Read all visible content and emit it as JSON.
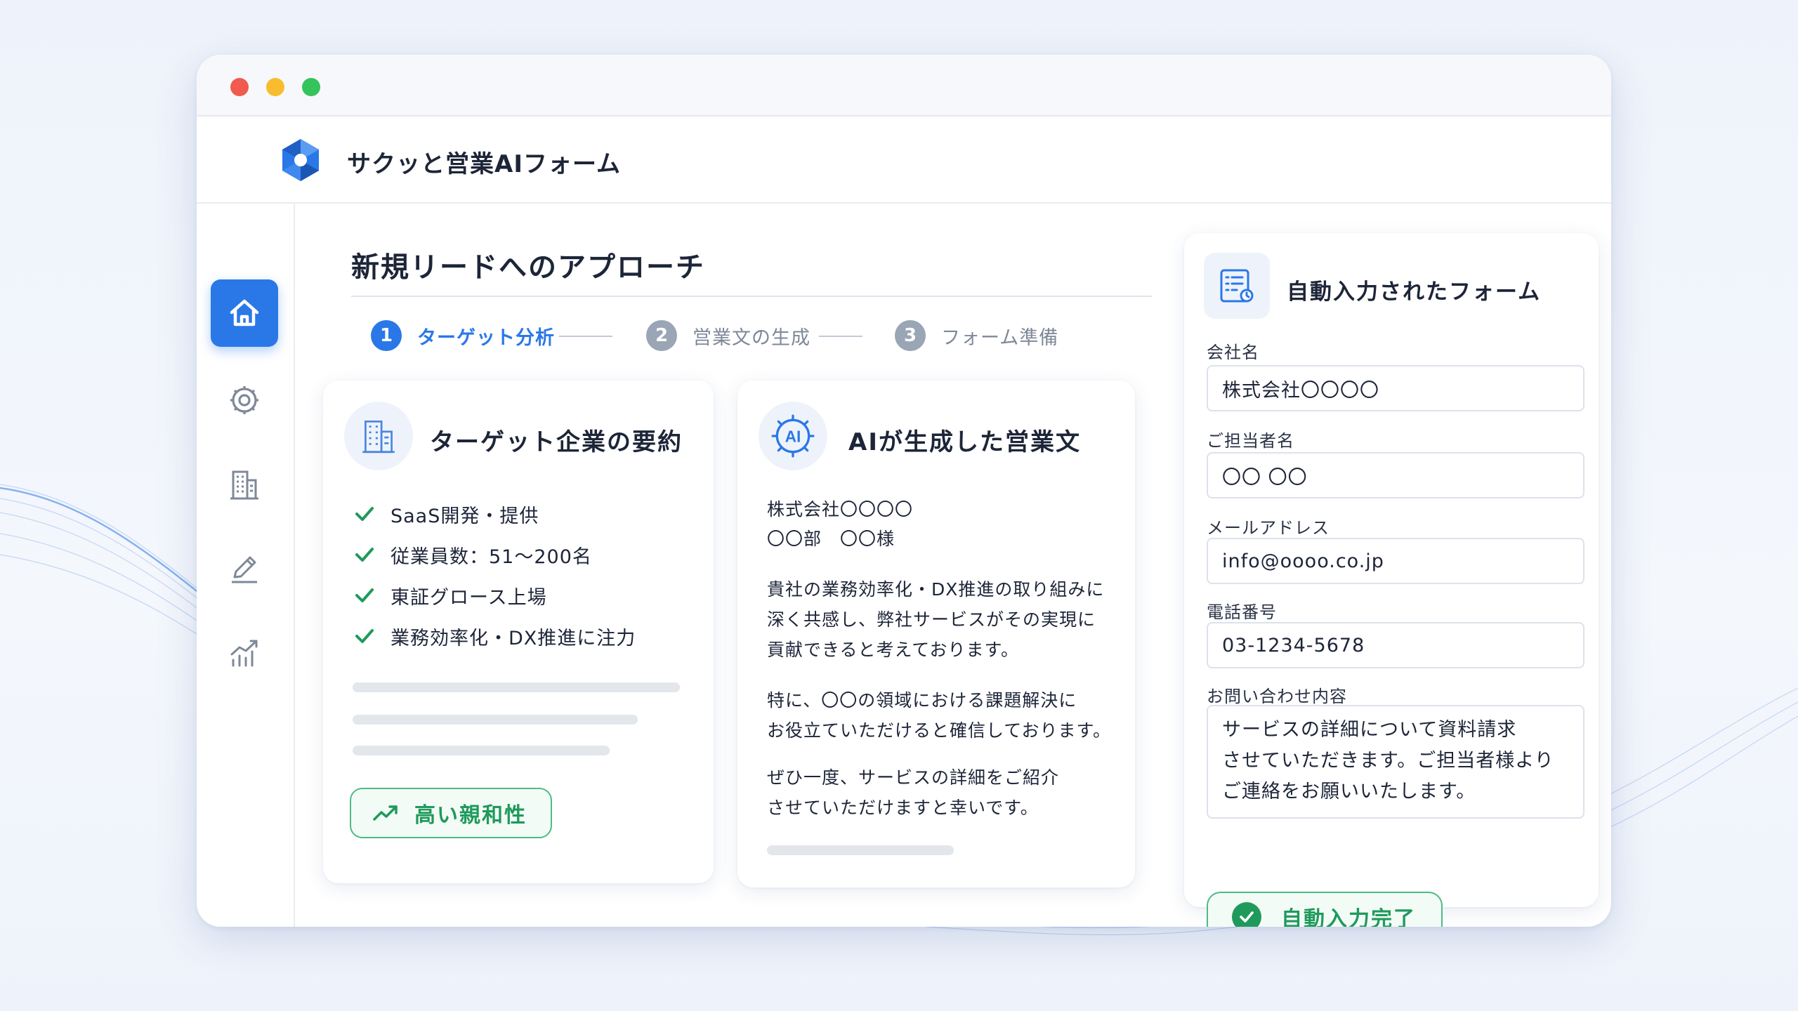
{
  "app": {
    "title": "サクッと営業AIフォーム",
    "accent_color": "#2a78e8",
    "success_color": "#1f9a5c"
  },
  "sidebar": {
    "items": [
      {
        "icon": "home-icon",
        "active": true
      },
      {
        "icon": "gear-icon",
        "active": false
      },
      {
        "icon": "building-icon",
        "active": false
      },
      {
        "icon": "pencil-icon",
        "active": false
      },
      {
        "icon": "chart-icon",
        "active": false
      }
    ]
  },
  "main": {
    "title": "新規リードへのアプローチ",
    "steps": [
      {
        "num": "1",
        "label": "ターゲット分析",
        "active": true
      },
      {
        "num": "2",
        "label": "営業文の生成",
        "active": false
      },
      {
        "num": "3",
        "label": "フォーム準備",
        "active": false
      }
    ]
  },
  "summary_card": {
    "title": "ターゲット企業の要約",
    "icon": "building-icon",
    "items": [
      "SaaS開発・提供",
      "従業員数：51〜200名",
      "東証グロース上場",
      "業務効率化・DX推進に注力"
    ],
    "badge": "高い親和性",
    "badge_icon": "trend-up-icon"
  },
  "ai_card": {
    "title": "AIが生成した営業文",
    "icon": "ai-chip-icon",
    "recipient": [
      "株式会社〇〇〇〇",
      "〇〇部　〇〇様"
    ],
    "paragraphs": [
      [
        "貴社の業務効率化・DX推進の取り組みに",
        "深く共感し、弊社サービスがその実現に",
        "貢献できると考えております。"
      ],
      [
        "特に、〇〇の領域における課題解決に",
        "お役立ていただけると確信しております。"
      ],
      [
        "ぜひ一度、サービスの詳細をご紹介",
        "させていただけますと幸いです。"
      ]
    ]
  },
  "form_card": {
    "title": "自動入力されたフォーム",
    "icon": "form-icon",
    "fields": {
      "company": {
        "label": "会社名",
        "value": "株式会社〇〇〇〇"
      },
      "person": {
        "label": "ご担当者名",
        "value": "〇〇  〇〇"
      },
      "email": {
        "label": "メールアドレス",
        "value": "info@oooo.co.jp"
      },
      "phone": {
        "label": "電話番号",
        "value": "03-1234-5678"
      },
      "inquiry": {
        "label": "お問い合わせ内容",
        "value": "サービスの詳細について資料請求\nさせていただきます。ご担当者様より\nご連絡をお願いいたします。"
      }
    },
    "done_label": "自動入力完了",
    "done_icon": "check-circle-icon"
  }
}
